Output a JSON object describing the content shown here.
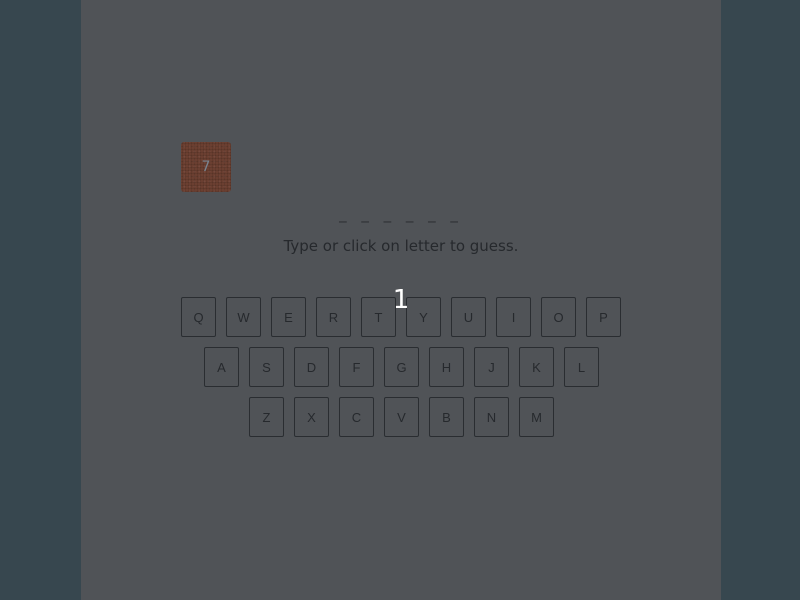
{
  "game": {
    "tries_remaining": "7",
    "word_blanks": "_ _ _ _ _ _",
    "instructions": "Type or click on letter to guess.",
    "floating_counter": "1"
  },
  "keyboard": {
    "row1": [
      "Q",
      "W",
      "E",
      "R",
      "T",
      "Y",
      "U",
      "I",
      "O",
      "P"
    ],
    "row2": [
      "A",
      "S",
      "D",
      "F",
      "G",
      "H",
      "J",
      "K",
      "L"
    ],
    "row3": [
      "Z",
      "X",
      "C",
      "V",
      "B",
      "N",
      "M"
    ]
  },
  "colors": {
    "background": "#37474f",
    "panel": "#505357",
    "badge": "#6b3f31"
  }
}
